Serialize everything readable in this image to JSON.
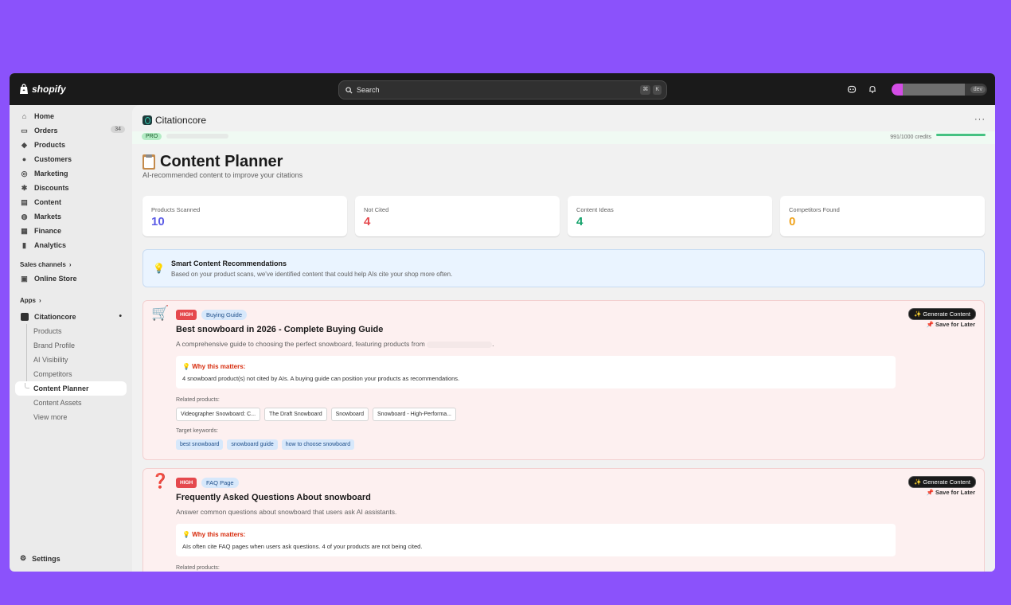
{
  "topbar": {
    "brand": "shopify",
    "search_placeholder": "Search",
    "shortcut_keys": [
      "⌘",
      "K"
    ],
    "account_badge": "dev"
  },
  "sidebar": {
    "items": [
      {
        "label": "Home",
        "icon": "⌂"
      },
      {
        "label": "Orders",
        "icon": "▭",
        "badge": "34"
      },
      {
        "label": "Products",
        "icon": "◆"
      },
      {
        "label": "Customers",
        "icon": "●"
      },
      {
        "label": "Marketing",
        "icon": "◎"
      },
      {
        "label": "Discounts",
        "icon": "✱"
      },
      {
        "label": "Content",
        "icon": "▤"
      },
      {
        "label": "Markets",
        "icon": "◍"
      },
      {
        "label": "Finance",
        "icon": "▦"
      },
      {
        "label": "Analytics",
        "icon": "▮"
      }
    ],
    "sales_channels_label": "Sales channels",
    "online_store": {
      "label": "Online Store",
      "icon": "▣"
    },
    "apps_label": "Apps",
    "app": {
      "label": "Citationcore",
      "pin": "•"
    },
    "app_sub_items": [
      "Products",
      "Brand Profile",
      "AI Visibility",
      "Competitors",
      "Content Planner",
      "Content Assets",
      "View more"
    ],
    "settings_label": "Settings",
    "chevron": "›"
  },
  "app_header": {
    "title": "Citationcore",
    "menu": "···",
    "plan_badge": "PRO",
    "credits": "991/1000 credits"
  },
  "page": {
    "title": "Content Planner",
    "subtitle": "AI-recommended content to improve your citations"
  },
  "stats": [
    {
      "label": "Products Scanned",
      "value": "10",
      "color": "#5c5ce6"
    },
    {
      "label": "Not Cited",
      "value": "4",
      "color": "#e5484d"
    },
    {
      "label": "Content Ideas",
      "value": "4",
      "color": "#15a36c"
    },
    {
      "label": "Competitors Found",
      "value": "0",
      "color": "#f0a31c"
    }
  ],
  "info_banner": {
    "icon": "💡",
    "title": "Smart Content Recommendations",
    "text": "Based on your product scans, we've identified content that could help AIs cite your shop more often."
  },
  "cards": [
    {
      "icon": "🛒",
      "priority": "HIGH",
      "type": "Buying Guide",
      "title": "Best snowboard in 2026 - Complete Buying Guide",
      "description": "A comprehensive guide to choosing the perfect snowboard, featuring products from",
      "description_end": ".",
      "why_title": "Why this matters:",
      "why_icon": "💡",
      "why_text": "4 snowboard product(s) not cited by AIs. A buying guide can position your products as recommendations.",
      "related_label": "Related products:",
      "related": [
        "Videographer Snowboard: C...",
        "The Draft Snowboard",
        "Snowboard",
        "Snowboard - High-Performa..."
      ],
      "keywords_label": "Target keywords:",
      "keywords": [
        "best snowboard",
        "snowboard guide",
        "how to choose snowboard"
      ],
      "generate_label": "✨ Generate Content",
      "save_label": "📌 Save for Later"
    },
    {
      "icon": "❓",
      "priority": "HIGH",
      "type": "FAQ Page",
      "title": "Frequently Asked Questions About snowboard",
      "description": "Answer common questions about snowboard that users ask AI assistants.",
      "why_title": "Why this matters:",
      "why_icon": "💡",
      "why_text": "AIs often cite FAQ pages when users ask questions. 4 of your products are not being cited.",
      "related_label": "Related products:",
      "generate_label": "✨ Generate Content",
      "save_label": "📌 Save for Later"
    }
  ]
}
